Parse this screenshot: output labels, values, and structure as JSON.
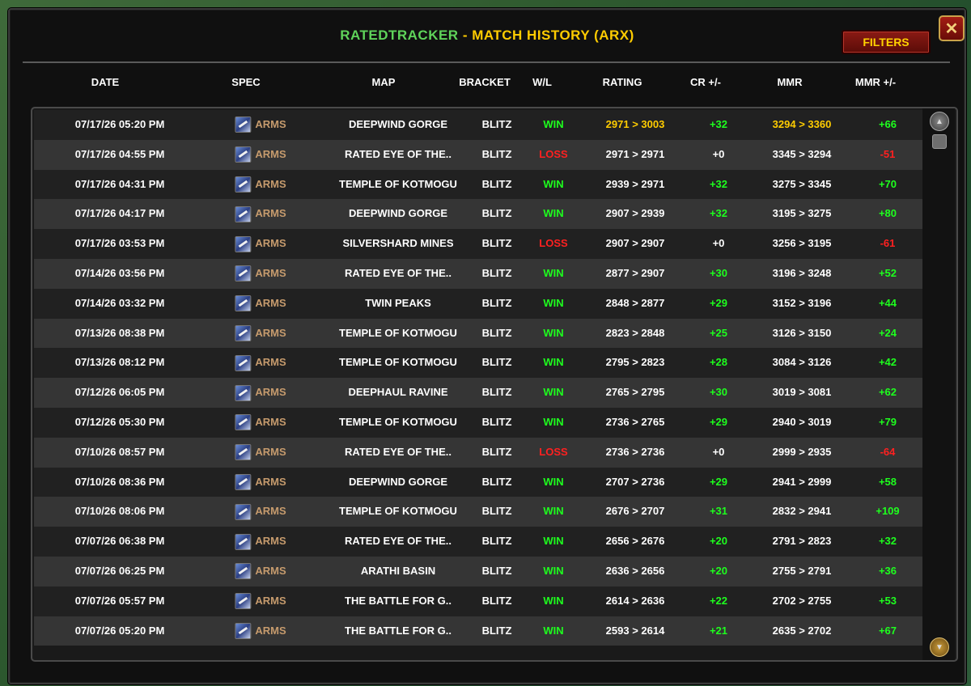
{
  "title": {
    "app": "RATEDTRACKER",
    "sep": " - ",
    "rest": "MATCH HISTORY (ARX)"
  },
  "filters_label": "FILTERS",
  "close_label": "✕",
  "columns": {
    "date": "DATE",
    "spec": "SPEC",
    "map": "MAP",
    "bracket": "BRACKET",
    "wl": "W/L",
    "rating": "RATING",
    "cr": "CR +/-",
    "mmr": "MMR",
    "mmrdiff": "MMR +/-"
  },
  "colors": {
    "app": "#5fd35a",
    "gold": "#ffcc00",
    "win": "#1eff1e",
    "loss": "#ff2020",
    "spec": "#c69b6d"
  },
  "icons": {
    "spec": "arms-spec-icon",
    "close": "close-icon",
    "scroll_up": "scroll-up-icon",
    "scroll_down": "scroll-down-icon"
  },
  "rows": [
    {
      "date": "07/17/26 05:20 PM",
      "spec": "ARMS",
      "map": "DEEPWIND GORGE",
      "bracket": "BLITZ",
      "wl": "WIN",
      "rating": "2971 > 3003",
      "cr": "+32",
      "mmr": "3294 > 3360",
      "mmrdiff": "+66",
      "highlight": true
    },
    {
      "date": "07/17/26 04:55 PM",
      "spec": "ARMS",
      "map": "RATED EYE OF THE..",
      "bracket": "BLITZ",
      "wl": "LOSS",
      "rating": "2971 > 2971",
      "cr": "+0",
      "mmr": "3345 > 3294",
      "mmrdiff": "-51"
    },
    {
      "date": "07/17/26 04:31 PM",
      "spec": "ARMS",
      "map": "TEMPLE OF KOTMOGU",
      "bracket": "BLITZ",
      "wl": "WIN",
      "rating": "2939 > 2971",
      "cr": "+32",
      "mmr": "3275 > 3345",
      "mmrdiff": "+70"
    },
    {
      "date": "07/17/26 04:17 PM",
      "spec": "ARMS",
      "map": "DEEPWIND GORGE",
      "bracket": "BLITZ",
      "wl": "WIN",
      "rating": "2907 > 2939",
      "cr": "+32",
      "mmr": "3195 > 3275",
      "mmrdiff": "+80"
    },
    {
      "date": "07/17/26 03:53 PM",
      "spec": "ARMS",
      "map": "SILVERSHARD MINES",
      "bracket": "BLITZ",
      "wl": "LOSS",
      "rating": "2907 > 2907",
      "cr": "+0",
      "mmr": "3256 > 3195",
      "mmrdiff": "-61"
    },
    {
      "date": "07/14/26 03:56 PM",
      "spec": "ARMS",
      "map": "RATED EYE OF THE..",
      "bracket": "BLITZ",
      "wl": "WIN",
      "rating": "2877 > 2907",
      "cr": "+30",
      "mmr": "3196 > 3248",
      "mmrdiff": "+52"
    },
    {
      "date": "07/14/26 03:32 PM",
      "spec": "ARMS",
      "map": "TWIN PEAKS",
      "bracket": "BLITZ",
      "wl": "WIN",
      "rating": "2848 > 2877",
      "cr": "+29",
      "mmr": "3152 > 3196",
      "mmrdiff": "+44"
    },
    {
      "date": "07/13/26 08:38 PM",
      "spec": "ARMS",
      "map": "TEMPLE OF KOTMOGU",
      "bracket": "BLITZ",
      "wl": "WIN",
      "rating": "2823 > 2848",
      "cr": "+25",
      "mmr": "3126 > 3150",
      "mmrdiff": "+24"
    },
    {
      "date": "07/13/26 08:12 PM",
      "spec": "ARMS",
      "map": "TEMPLE OF KOTMOGU",
      "bracket": "BLITZ",
      "wl": "WIN",
      "rating": "2795 > 2823",
      "cr": "+28",
      "mmr": "3084 > 3126",
      "mmrdiff": "+42"
    },
    {
      "date": "07/12/26 06:05 PM",
      "spec": "ARMS",
      "map": "DEEPHAUL RAVINE",
      "bracket": "BLITZ",
      "wl": "WIN",
      "rating": "2765 > 2795",
      "cr": "+30",
      "mmr": "3019 > 3081",
      "mmrdiff": "+62"
    },
    {
      "date": "07/12/26 05:30 PM",
      "spec": "ARMS",
      "map": "TEMPLE OF KOTMOGU",
      "bracket": "BLITZ",
      "wl": "WIN",
      "rating": "2736 > 2765",
      "cr": "+29",
      "mmr": "2940 > 3019",
      "mmrdiff": "+79"
    },
    {
      "date": "07/10/26 08:57 PM",
      "spec": "ARMS",
      "map": "RATED EYE OF THE..",
      "bracket": "BLITZ",
      "wl": "LOSS",
      "rating": "2736 > 2736",
      "cr": "+0",
      "mmr": "2999 > 2935",
      "mmrdiff": "-64"
    },
    {
      "date": "07/10/26 08:36 PM",
      "spec": "ARMS",
      "map": "DEEPWIND GORGE",
      "bracket": "BLITZ",
      "wl": "WIN",
      "rating": "2707 > 2736",
      "cr": "+29",
      "mmr": "2941 > 2999",
      "mmrdiff": "+58"
    },
    {
      "date": "07/10/26 08:06 PM",
      "spec": "ARMS",
      "map": "TEMPLE OF KOTMOGU",
      "bracket": "BLITZ",
      "wl": "WIN",
      "rating": "2676 > 2707",
      "cr": "+31",
      "mmr": "2832 > 2941",
      "mmrdiff": "+109"
    },
    {
      "date": "07/07/26 06:38 PM",
      "spec": "ARMS",
      "map": "RATED EYE OF THE..",
      "bracket": "BLITZ",
      "wl": "WIN",
      "rating": "2656 > 2676",
      "cr": "+20",
      "mmr": "2791 > 2823",
      "mmrdiff": "+32"
    },
    {
      "date": "07/07/26 06:25 PM",
      "spec": "ARMS",
      "map": "ARATHI BASIN",
      "bracket": "BLITZ",
      "wl": "WIN",
      "rating": "2636 > 2656",
      "cr": "+20",
      "mmr": "2755 > 2791",
      "mmrdiff": "+36"
    },
    {
      "date": "07/07/26 05:57 PM",
      "spec": "ARMS",
      "map": "THE BATTLE FOR G..",
      "bracket": "BLITZ",
      "wl": "WIN",
      "rating": "2614 > 2636",
      "cr": "+22",
      "mmr": "2702 > 2755",
      "mmrdiff": "+53"
    },
    {
      "date": "07/07/26 05:20 PM",
      "spec": "ARMS",
      "map": "THE BATTLE FOR G..",
      "bracket": "BLITZ",
      "wl": "WIN",
      "rating": "2593 > 2614",
      "cr": "+21",
      "mmr": "2635 > 2702",
      "mmrdiff": "+67"
    }
  ]
}
